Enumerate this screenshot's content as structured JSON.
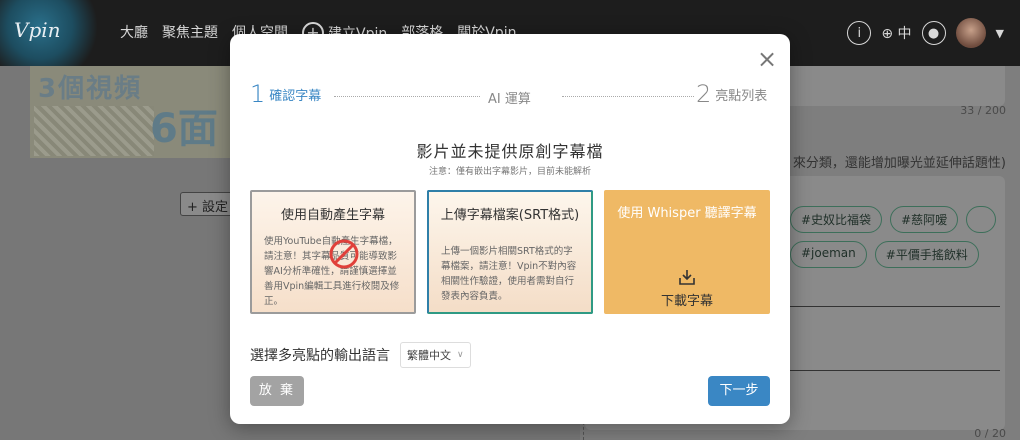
{
  "app": {
    "logo_text": "Vpin",
    "nav": [
      "大廳",
      "聚焦主題",
      "個人空間",
      "建立Vpin",
      "部落格",
      "關於Vpin"
    ],
    "lang_short": "中"
  },
  "background": {
    "thumbnail_text_1": "3個視頻",
    "thumbnail_text_2": "6面",
    "setting_button": "設定",
    "count_top": "33 / 200",
    "note_fragment": "來分類，還能增加曝光並延伸話題性)",
    "tags": [
      "#史奴比福袋",
      "#慈阿嗳",
      "",
      "#joeman",
      "#平價手搖飲料"
    ],
    "count_bottom": "0 / 20"
  },
  "modal": {
    "steps": {
      "step1_num": "1",
      "step1_label": "確認字幕",
      "middle_label": "AI 運算",
      "step2_num": "2",
      "step2_label": "亮點列表"
    },
    "heading": "影片並未提供原創字幕檔",
    "subnote": "注意：僅有嵌出字幕影片，目前未能解析",
    "options": [
      {
        "title": "使用自動產生字幕",
        "body": "使用YouTube自動產生字幕檔，請注意！其字幕品質可能導致影響AI分析準確性，請謹慎選擇並善用Vpin編輯工具進行校閱及修正。",
        "disabled": true
      },
      {
        "title": "上傳字幕檔案(SRT格式)",
        "body": "上傳一個影片相關SRT格式的字幕檔案，請注意！Vpin不對內容相關性作驗證，使用者需對自行發表內容負責。"
      },
      {
        "title": "使用 Whisper 聽譯字幕",
        "action_label": "下載字幕"
      }
    ],
    "language_label": "選擇多亮點的輸出語言",
    "language_value": "繁體中文",
    "cancel_label": "放 棄",
    "next_label": "下一步"
  },
  "colors": {
    "accent": "#3a87c4",
    "whisper_card": "#efb965",
    "cancel_bg": "#a3a3a3"
  }
}
